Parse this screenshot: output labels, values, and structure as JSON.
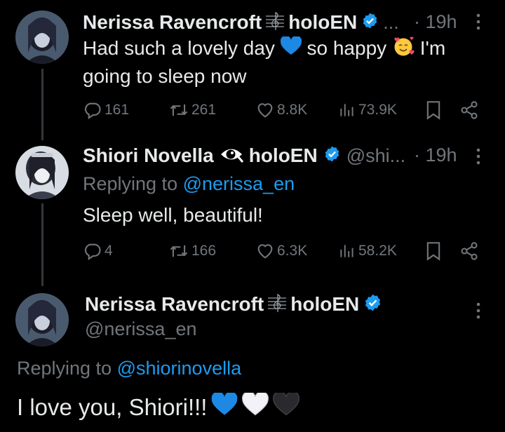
{
  "tweet1": {
    "name": "Nerissa Ravencroft",
    "name_suffix": "holoEN",
    "handle": "...",
    "time": "· 19h",
    "text_a": "Had such a lovely day",
    "text_b": "so happy",
    "text_c": "I'm",
    "text_d": "going to sleep now",
    "replies": "161",
    "reposts": "261",
    "likes": "8.8K",
    "views": "73.9K"
  },
  "tweet2": {
    "name": "Shiori Novella",
    "name_suffix": "holoEN",
    "handle": "@shi...",
    "time": "· 19h",
    "replying_prefix": "Replying to",
    "replying_handle": "@nerissa_en",
    "text": "Sleep well, beautiful!",
    "replies": "4",
    "reposts": "166",
    "likes": "6.3K",
    "views": "58.2K"
  },
  "main": {
    "name": "Nerissa Ravencroft",
    "name_suffix": "holoEN",
    "handle": "@nerissa_en",
    "replying_prefix": "Replying to",
    "replying_handle": "@shiorinovella",
    "text": "I love you, Shiori!!!"
  },
  "icons": {
    "verified": "verified-badge-icon",
    "music": "treble-clef-icon",
    "eye": "eye-icon",
    "more": "more-options-icon",
    "reply": "reply-icon",
    "repost": "repost-icon",
    "like": "heart-icon",
    "views": "views-icon",
    "bookmark": "bookmark-icon",
    "share": "share-icon"
  },
  "colors": {
    "background": "#000000",
    "text": "#e7e9ea",
    "muted": "#71767b",
    "accent": "#1d9bf0"
  }
}
